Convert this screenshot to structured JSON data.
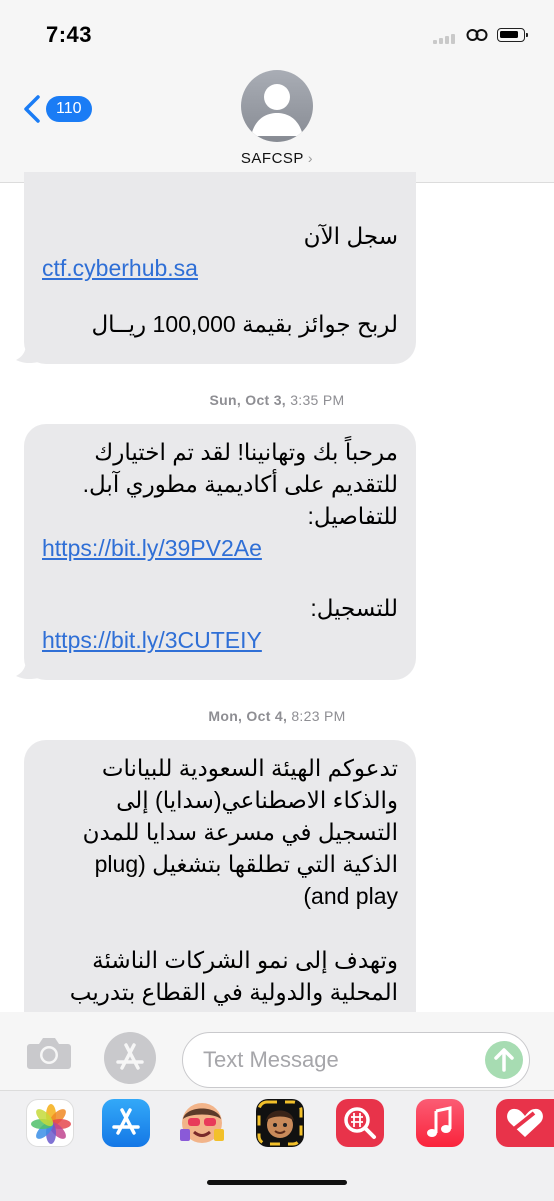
{
  "status_bar": {
    "time": "7:43"
  },
  "header": {
    "back_count": "110",
    "contact_name": "SAFCSP",
    "contact_chevron": "›"
  },
  "messages": [
    {
      "lines": [
        "سجل الآن"
      ],
      "link": "ctf.cyberhub.sa",
      "after": [
        "لربح جوائز بقيمة 100,000 ريــال"
      ]
    },
    {
      "timestamp_day": "Sun, Oct 3,",
      "timestamp_time": "3:35 PM",
      "lines": [
        "مرحباً بك وتهانينا! لقد تم اختيارك",
        "للتقديم على أكاديمية مطوري آبل.",
        "للتفاصيل:"
      ],
      "link1": "https://bit.ly/39PV2Ae",
      "label2": "للتسجيل:",
      "link2": "https://bit.ly/3CUTEIY"
    },
    {
      "timestamp_day": "Mon, Oct 4,",
      "timestamp_time": "8:23 PM",
      "lines": [
        "تدعوكم الهيئة السعودية للبيانات",
        "والذكاء الاصطناعي(سدايا) إلى",
        "التسجيل في مسرعة سدايا للمدن",
        "الذكية التي تطلقها بتشغيل (plug",
        "and play)",
        "",
        "وتهدف إلى نمو الشركات الناشئة",
        "المحلية والدولية في القطاع بتدريب"
      ]
    }
  ],
  "composer": {
    "placeholder": "Text Message"
  },
  "apps": [
    "photos-icon",
    "app-store-icon",
    "memoji-stickers-icon",
    "memoji-icon",
    "search-images-icon",
    "music-icon",
    "fitness-icon"
  ],
  "colors": {
    "bubble": "#e9e9eb",
    "link": "#2f6fd6",
    "accent": "#1a7cf5",
    "send": "#a7dcb2"
  }
}
